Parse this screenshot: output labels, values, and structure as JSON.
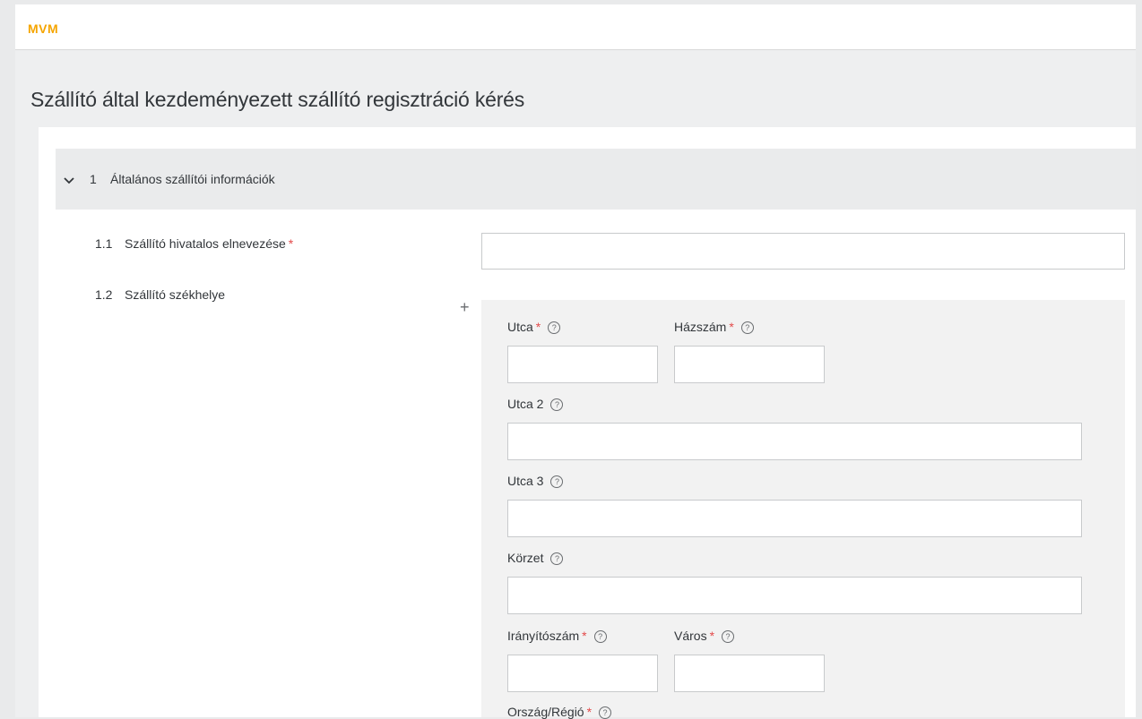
{
  "header": {
    "logo": "MVM"
  },
  "page": {
    "title": "Szállító által kezdeményezett szállító regisztráció kérés"
  },
  "section": {
    "number": "1",
    "title": "Általános szállítói információk"
  },
  "questions": [
    {
      "number": "1.1",
      "label": "Szállító hivatalos elnevezése",
      "required": "*",
      "value": ""
    },
    {
      "number": "1.2",
      "label": "Szállító székhelye"
    }
  ],
  "address": {
    "street": {
      "label": "Utca",
      "required": "*",
      "value": ""
    },
    "house_number": {
      "label": "Házszám",
      "required": "*",
      "value": ""
    },
    "street2": {
      "label": "Utca 2",
      "value": ""
    },
    "street3": {
      "label": "Utca 3",
      "value": ""
    },
    "district": {
      "label": "Körzet",
      "value": ""
    },
    "postal_code": {
      "label": "Irányítószám",
      "required": "*",
      "value": ""
    },
    "city": {
      "label": "Város",
      "required": "*",
      "value": ""
    },
    "country": {
      "label": "Ország/Régió",
      "required": "*"
    },
    "help_glyph": "?",
    "add_glyph": "+"
  },
  "colors": {
    "logo": "#f5a500",
    "required": "#e34a4a",
    "background": "#eeeff0"
  },
  "icons": {
    "section_toggle": "chevron-down-icon",
    "help": "help-circle-icon",
    "add": "plus-icon"
  }
}
